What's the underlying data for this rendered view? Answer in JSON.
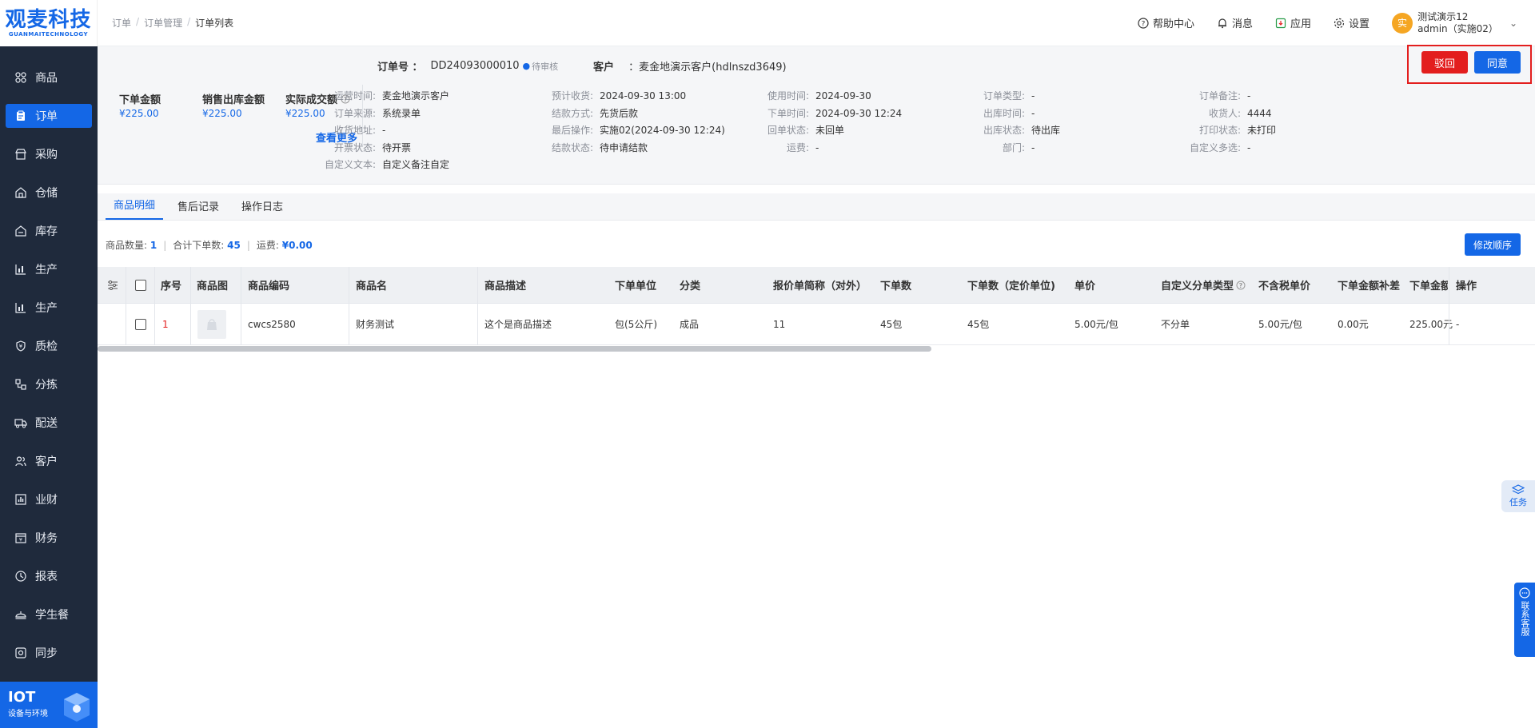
{
  "brand": {
    "name": "观麦科技",
    "sub": "GUANMAITECHNOLOGY"
  },
  "sidebar": {
    "items": [
      {
        "label": "商品",
        "icon": "grid-icon"
      },
      {
        "label": "订单",
        "icon": "order-icon",
        "active": true
      },
      {
        "label": "采购",
        "icon": "shop-icon"
      },
      {
        "label": "仓储",
        "icon": "warehouse-icon"
      },
      {
        "label": "库存",
        "icon": "inventory-icon"
      },
      {
        "label": "生产",
        "icon": "chart-icon"
      },
      {
        "label": "生产",
        "icon": "chart-icon"
      },
      {
        "label": "质检",
        "icon": "shield-icon"
      },
      {
        "label": "分拣",
        "icon": "sort-icon"
      },
      {
        "label": "配送",
        "icon": "truck-icon"
      },
      {
        "label": "客户",
        "icon": "users-icon"
      },
      {
        "label": "业财",
        "icon": "bar-chart-icon"
      },
      {
        "label": "财务",
        "icon": "finance-icon"
      },
      {
        "label": "报表",
        "icon": "report-icon"
      },
      {
        "label": "学生餐",
        "icon": "meal-icon"
      },
      {
        "label": "同步",
        "icon": "sync-icon"
      }
    ],
    "iot": {
      "title": "IOT",
      "sub": "设备与环境"
    }
  },
  "breadcrumb": [
    "订单",
    "订单管理",
    "订单列表"
  ],
  "topbar": {
    "help": "帮助中心",
    "message": "消息",
    "apps": "应用",
    "settings": "设置",
    "avatar_text": "实",
    "user_name": "测试演示12",
    "user_account": "admin（实施02）"
  },
  "order": {
    "no_label": "订单号 ：",
    "no": "DD24093000010",
    "status": "待审核",
    "customer_label": "客户",
    "customer": "：麦金地演示客户(hdlnszd3649)",
    "reject": "驳回",
    "agree": "同意",
    "amounts": [
      {
        "label": "下单金额",
        "value": "¥225.00"
      },
      {
        "label": "销售出库金额",
        "value": "¥225.00"
      },
      {
        "label": "实际成交额",
        "value": "¥225.00",
        "help": true
      }
    ],
    "see_more": "查看更多",
    "info_cols": [
      [
        {
          "k": "运营时间:",
          "v": "麦金地演示客户"
        },
        {
          "k": "订单来源:",
          "v": "系统录单"
        },
        {
          "k": "收货地址:",
          "v": "-"
        },
        {
          "k": "开票状态:",
          "v": "待开票"
        },
        {
          "k": "自定义文本:",
          "v": "自定义备注自定"
        }
      ],
      [
        {
          "k": "预计收货:",
          "v": "2024-09-30 13:00"
        },
        {
          "k": "结款方式:",
          "v": "先货后款"
        },
        {
          "k": "最后操作:",
          "v": "实施02(2024-09-30 12:24)"
        },
        {
          "k": "结款状态:",
          "v": "待申请结款"
        }
      ],
      [
        {
          "k": "使用时间:",
          "v": "2024-09-30"
        },
        {
          "k": "下单时间:",
          "v": "2024-09-30 12:24"
        },
        {
          "k": "回单状态:",
          "v": "未回单"
        },
        {
          "k": "运费:",
          "v": "-"
        }
      ],
      [
        {
          "k": "订单类型:",
          "v": "-"
        },
        {
          "k": "出库时间:",
          "v": "-"
        },
        {
          "k": "出库状态:",
          "v": "待出库"
        },
        {
          "k": "部门:",
          "v": "-"
        }
      ],
      [
        {
          "k": "订单备注:",
          "v": "-"
        },
        {
          "k": "收货人:",
          "v": "4444"
        },
        {
          "k": "打印状态:",
          "v": "未打印"
        },
        {
          "k": "自定义多选:",
          "v": "-"
        }
      ]
    ]
  },
  "tabs": [
    "商品明细",
    "售后记录",
    "操作日志"
  ],
  "summary": {
    "count_label": "商品数量:",
    "count": "1",
    "total_label": "合计下单数:",
    "total": "45",
    "freight_label": "运费:",
    "freight": "¥0.00"
  },
  "modify_order_btn": "修改顺序",
  "table": {
    "headers": [
      "序号",
      "商品图",
      "商品编码",
      "商品名",
      "商品描述",
      "下单单位",
      "分类",
      "报价单简称（对外）",
      "下单数",
      "下单数（定价单位)",
      "单价",
      "自定义分单类型",
      "不含税单价",
      "下单金额补差",
      "下单金额",
      "操作"
    ],
    "rows": [
      [
        "1",
        "",
        "cwcs2580",
        "财务测试",
        "这个是商品描述",
        "包(5公斤)",
        "成品",
        "11",
        "45包",
        "45包",
        "5.00元/包",
        "不分单",
        "5.00元/包",
        "0.00元",
        "225.00元",
        "-"
      ]
    ]
  },
  "floats": {
    "task": "任务",
    "service": "联系客服"
  }
}
